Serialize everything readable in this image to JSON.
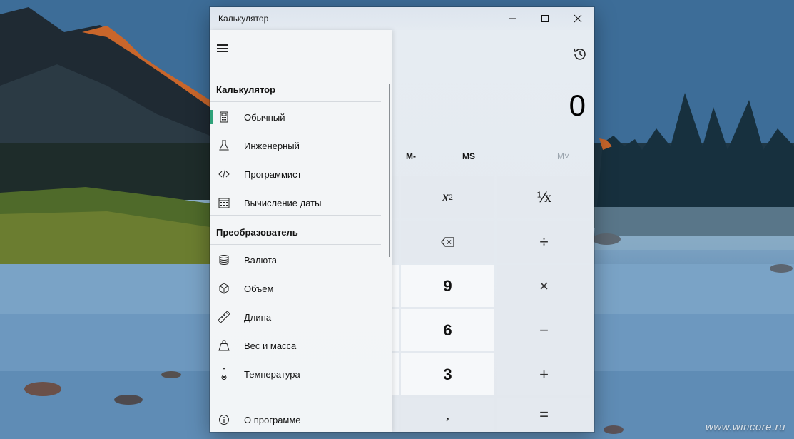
{
  "window": {
    "title": "Калькулятор",
    "minimize_label": "",
    "maximize_label": "",
    "close_label": ""
  },
  "display": {
    "value": "0"
  },
  "memory": {
    "m_minus": "M-",
    "ms": "MS",
    "m_view": "M˅"
  },
  "keys": {
    "square_base": "x",
    "square_exp": "2",
    "reciprocal": "⅟x",
    "backspace_icon": "backspace-icon",
    "divide": "÷",
    "nine": "9",
    "multiply": "×",
    "six": "6",
    "minus": "−",
    "three": "3",
    "plus": "+",
    "decimal": ",",
    "equals": "="
  },
  "nav": {
    "section_calculator": "Калькулятор",
    "section_converter": "Преобразователь",
    "items": [
      {
        "label": "Обычный",
        "icon": "calculator-icon",
        "active": true
      },
      {
        "label": "Инженерный",
        "icon": "flask-icon",
        "active": false
      },
      {
        "label": "Программист",
        "icon": "code-icon",
        "active": false
      },
      {
        "label": "Вычисление даты",
        "icon": "calendar-icon",
        "active": false
      }
    ],
    "converter_items": [
      {
        "label": "Валюта",
        "icon": "currency-icon"
      },
      {
        "label": "Объем",
        "icon": "cube-icon"
      },
      {
        "label": "Длина",
        "icon": "ruler-icon"
      },
      {
        "label": "Вес и масса",
        "icon": "weight-icon"
      },
      {
        "label": "Температура",
        "icon": "thermometer-icon"
      }
    ],
    "about": {
      "label": "О программе",
      "icon": "info-icon"
    }
  },
  "desktop": {
    "watermark": "www.wincore.ru"
  },
  "colors": {
    "accent": "#2fa27a"
  }
}
